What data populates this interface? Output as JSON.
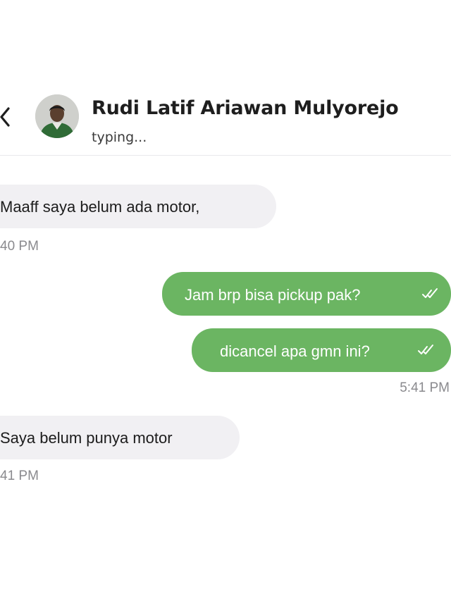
{
  "header": {
    "back_icon": "chevron-left-icon",
    "contact_name": "Rudi Latif Ariawan Mulyorejo",
    "status": "typing..."
  },
  "messages": [
    {
      "direction": "incoming",
      "text": "Maaff saya belum ada motor,",
      "time": "40 PM"
    },
    {
      "direction": "outgoing",
      "text": "Jam brp bisa pickup pak?",
      "status_icon": "double-check-icon"
    },
    {
      "direction": "outgoing",
      "text": "dicancel apa gmn ini?",
      "status_icon": "double-check-icon",
      "time": "5:41 PM"
    },
    {
      "direction": "incoming",
      "text": "Saya belum punya motor",
      "time": "41 PM"
    }
  ],
  "colors": {
    "outgoing_bubble": "#6bb562",
    "incoming_bubble": "#f1f0f3",
    "timestamp": "#8a8a8e"
  }
}
